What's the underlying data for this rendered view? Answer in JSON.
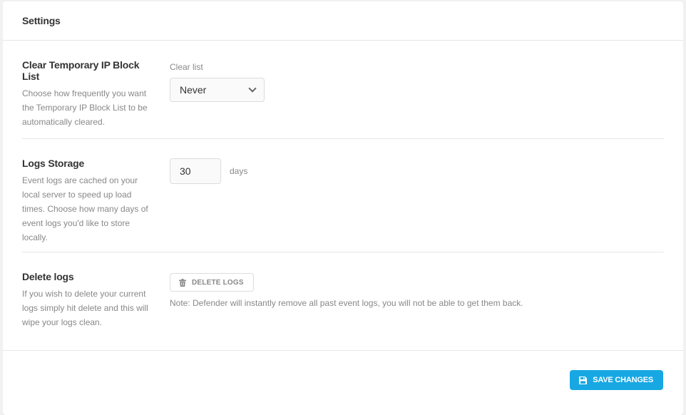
{
  "header": {
    "title": "Settings"
  },
  "clear_list": {
    "title": "Clear Temporary IP Block List",
    "description": "Choose how frequently you want the Temporary IP Block List to be automatically cleared.",
    "field_label": "Clear list",
    "selected": "Never",
    "icon": "chevron-down-icon"
  },
  "logs_storage": {
    "title": "Logs Storage",
    "description": "Event logs are cached on your local server to speed up load times. Choose how many days of event logs you'd like to store locally.",
    "value": "30",
    "unit": "days"
  },
  "delete_logs": {
    "title": "Delete logs",
    "description": "If you wish to delete your current logs simply hit delete and this will wipe your logs clean.",
    "button_label": "DELETE LOGS",
    "button_icon": "trash-icon",
    "note": "Note: Defender will instantly remove all past event logs, you will not be able to get them back."
  },
  "footer": {
    "save_label": "SAVE CHANGES",
    "save_icon": "save-icon",
    "accent_color": "#17a8e3"
  }
}
